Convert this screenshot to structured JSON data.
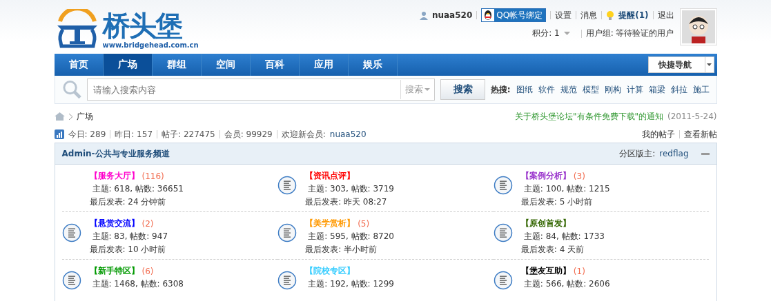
{
  "logo": {
    "name": "桥头堡",
    "url": "www.bridgehead.com.cn"
  },
  "user_bar": {
    "username": "nuaa520",
    "qq_button": "QQ帐号绑定",
    "links": [
      {
        "label": "设置",
        "kind": "plain"
      },
      {
        "label": "消息",
        "kind": "plain"
      },
      {
        "label": "提醒(1)",
        "kind": "alert"
      },
      {
        "label": "退出",
        "kind": "plain"
      }
    ],
    "credits": "积分: 1",
    "group": "用户组: 等待验证的用户"
  },
  "nav": {
    "items": [
      {
        "label": "首页",
        "selected": false
      },
      {
        "label": "广场",
        "selected": true
      },
      {
        "label": "群组",
        "selected": false
      },
      {
        "label": "空间",
        "selected": false
      },
      {
        "label": "百科",
        "selected": false
      },
      {
        "label": "应用",
        "selected": false
      },
      {
        "label": "娱乐",
        "selected": false
      }
    ],
    "quick_nav": "快捷导航"
  },
  "search": {
    "placeholder": "请输入搜索内容",
    "scope": "搜索",
    "button": "搜索",
    "hot_label": "热搜:",
    "hot": [
      "图纸",
      "软件",
      "规范",
      "模型",
      "刚构",
      "计算",
      "箱梁",
      "斜拉",
      "施工"
    ]
  },
  "breadcrumb": {
    "current": "广场",
    "notice": "关于桥头堡论坛\"有条件免费下载\"的通知",
    "notice_date": "(2011-5-24)"
  },
  "stats": {
    "items": [
      "今日: 289",
      "昨日: 157",
      "帖子: 227475",
      "会员: 99929"
    ],
    "welcome": "欢迎新会员:",
    "new_member": "nuaa520",
    "links": [
      "我的帖子",
      "查看新帖"
    ]
  },
  "section": {
    "title": "Admin-公共与专业服务频道",
    "moderator_label": "分区版主:",
    "moderator": "redflag",
    "expanded": true,
    "forums": [
      {
        "name": "【服务大厅】",
        "color": "#ff00cc",
        "today": "(116)",
        "topics": "主题: 618, 帖数: 36651",
        "last": "最后发表: 24 分钟前",
        "has_icon": false
      },
      {
        "name": "【资讯点评】",
        "color": "#ff0000",
        "topics": "主题: 303, 帖数: 3719",
        "last": "最后发表: 昨天 08:27",
        "has_icon": true
      },
      {
        "name": "【案例分析】",
        "color": "#9933cc",
        "today": "(3)",
        "topics": "主题: 100, 帖数: 1215",
        "last": "最后发表: 5 小时前",
        "has_icon": true
      },
      {
        "name": "【悬赏交流】",
        "color": "#0000ff",
        "today": "(2)",
        "topics": "主题: 83, 帖数: 947",
        "last": "最后发表: 10 小时前",
        "has_icon": true
      },
      {
        "name": "【美学赏析】",
        "color": "#ff9900",
        "today": "(5)",
        "topics": "主题: 595, 帖数: 8720",
        "last": "最后发表: 半小时前",
        "has_icon": true
      },
      {
        "name": "【原创首发】",
        "color": "#336600",
        "topics": "主题: 84, 帖数: 1733",
        "last": "最后发表: 4 天前",
        "has_icon": true
      },
      {
        "name": "【新手特区】",
        "color": "#009900",
        "today": "(6)",
        "topics": "主题: 1468, 帖数: 6308",
        "has_icon": true
      },
      {
        "name": "【院校专区】",
        "color": "#33ccff",
        "topics": "主题: 192, 帖数: 1299",
        "has_icon": true
      },
      {
        "name": "【堡友互助】",
        "color": "#000000",
        "today": "(1)",
        "topics": "主题: 566, 帖数: 2606",
        "has_icon": true
      }
    ]
  }
}
